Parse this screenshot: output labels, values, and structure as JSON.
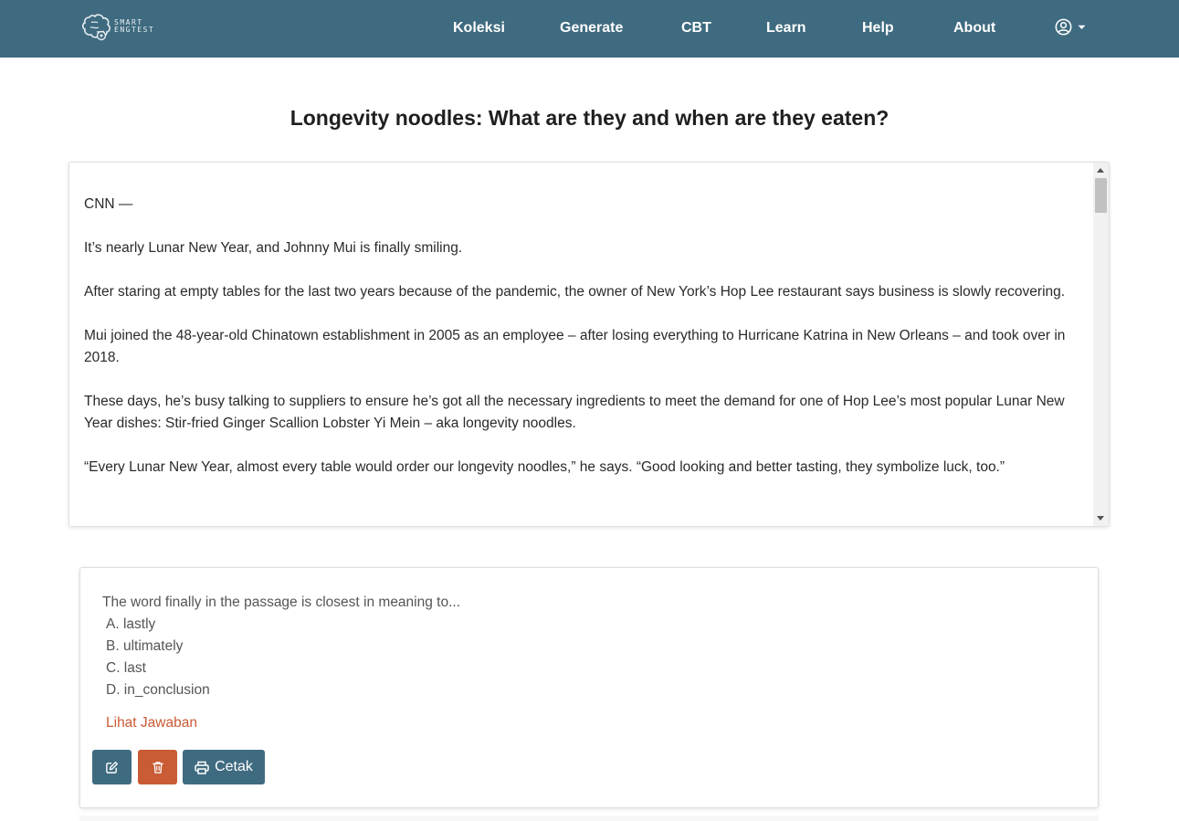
{
  "brand": {
    "line1": "SMART",
    "line2": "ENGTEST"
  },
  "nav": {
    "items": [
      {
        "label": "Koleksi"
      },
      {
        "label": "Generate"
      },
      {
        "label": "CBT"
      },
      {
        "label": "Learn"
      },
      {
        "label": "Help"
      },
      {
        "label": "About"
      }
    ]
  },
  "article": {
    "title": "Longevity noodles: What are they and when are they eaten?",
    "paragraphs": [
      "CNN —",
      "It’s nearly Lunar New Year, and Johnny Mui is finally smiling.",
      "After staring at empty tables for the last two years because of the pandemic, the owner of New York’s Hop Lee restaurant says business is slowly recovering.",
      "Mui joined the 48-year-old Chinatown establishment in 2005 as an employee – after losing everything to Hurricane Katrina in New Orleans – and took over in 2018.",
      "These days, he’s busy talking to suppliers to ensure he’s got all the necessary ingredients to meet the demand for one of Hop Lee’s most popular Lunar New Year dishes: Stir-fried Ginger Scallion Lobster Yi Mein – aka longevity noodles.",
      "“Every Lunar New Year, almost every table would order our longevity noodles,” he says. “Good looking and better tasting, they symbolize luck, too.”"
    ]
  },
  "question": {
    "text": "The word finally in the passage is closest in meaning to...",
    "options": [
      "A. lastly",
      "B. ultimately",
      "C. last",
      "D. in_conclusion"
    ],
    "answer_link": "Lihat Jawaban",
    "print_label": "Cetak"
  },
  "colors": {
    "primary": "#3f6b80",
    "danger": "#c95b35"
  },
  "icons": {
    "edit": "edit-icon",
    "delete": "trash-icon",
    "print": "printer-icon",
    "user": "user-circle-icon",
    "caret": "caret-down-icon"
  }
}
